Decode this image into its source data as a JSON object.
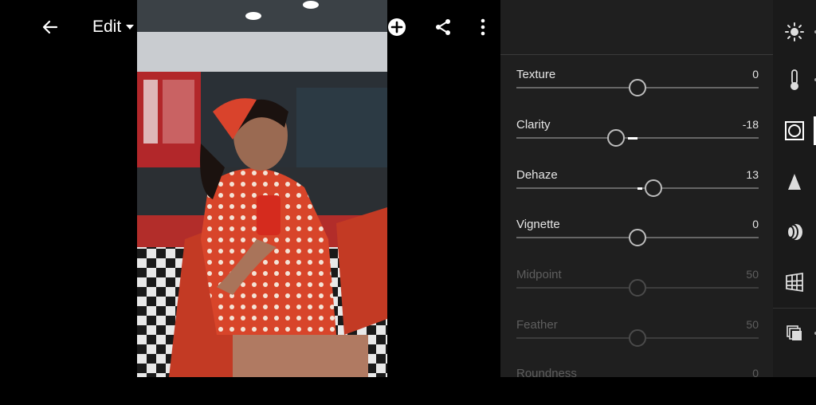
{
  "toolbar": {
    "back_icon": "back-arrow-icon",
    "edit_label": "Edit",
    "undo_icon": "undo-icon",
    "presets_icon": "presets-icon",
    "add_icon": "add-circle-icon",
    "share_icon": "share-icon",
    "more_icon": "more-vertical-icon"
  },
  "panel": {
    "sliders": [
      {
        "label": "Texture",
        "value": "0",
        "position": 0.5,
        "fill_from": 0.5,
        "fill_to": 0.5,
        "disabled": false
      },
      {
        "label": "Clarity",
        "value": "-18",
        "position": 0.41,
        "fill_from": 0.46,
        "fill_to": 0.5,
        "disabled": false
      },
      {
        "label": "Dehaze",
        "value": "13",
        "position": 0.565,
        "fill_from": 0.5,
        "fill_to": 0.52,
        "disabled": false
      },
      {
        "label": "Vignette",
        "value": "0",
        "position": 0.5,
        "fill_from": 0.5,
        "fill_to": 0.5,
        "disabled": false
      },
      {
        "label": "Midpoint",
        "value": "50",
        "position": 0.5,
        "fill_from": 0.5,
        "fill_to": 0.5,
        "disabled": true
      },
      {
        "label": "Feather",
        "value": "50",
        "position": 0.5,
        "fill_from": 0.5,
        "fill_to": 0.5,
        "disabled": true
      },
      {
        "label": "Roundness",
        "value": "0",
        "position": 0.5,
        "fill_from": 0.5,
        "fill_to": 0.5,
        "disabled": true
      }
    ]
  },
  "rail": {
    "items": [
      "light-icon",
      "color-icon",
      "effects-icon",
      "detail-icon",
      "optics-icon",
      "geometry-icon",
      "versions-icon"
    ],
    "active": "effects-icon"
  },
  "colors": {
    "panel_bg": "#1f1f1f",
    "rail_bg": "#1a1a1a",
    "photo_dress": "#d8452a"
  }
}
